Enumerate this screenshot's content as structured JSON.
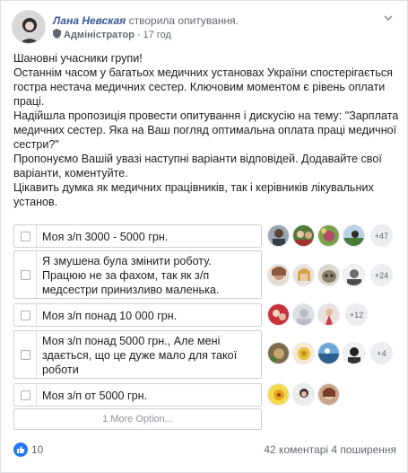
{
  "post": {
    "author": "Лана Невская",
    "action": "створила опитування.",
    "role": "Адміністратор",
    "separator": "·",
    "time": "17 год",
    "text_lines": [
      "Шановні учасники групи!",
      "Останнім часом у багатьох медичних установах України спостерігається гостра нестача медичних сестер. Ключовим моментом є рівень оплати праці.",
      "Надійшла пропозиція провести опитування і дискусію на тему: \"Зарплата медичних сестер. Яка на Ваш погляд оптимальна оплата праці медичної сестри?\"",
      "Пропонуємо Вашій увазі наступні варіанти відповідей. Додавайте свої варіанти, коментуйте.",
      "Цікавить думка як медичних працівників, так і керівників лікувальних установ."
    ]
  },
  "poll": {
    "options": [
      {
        "label": "Моя з/п 3000 - 5000 грн.",
        "more": "+47"
      },
      {
        "label": "Я змушена була змінити роботу. Працюю не за фахом, так як з/п медсестри принизливо маленька.",
        "more": "+24"
      },
      {
        "label": "Моя з/п понад 10 000 грн.",
        "more": "+12"
      },
      {
        "label": "Моя з/п понад 5000 грн., Але мені здається, що це дуже мало для такої роботи",
        "more": "+4"
      },
      {
        "label": "Моя з/п от 5000 грн.",
        "more": ""
      }
    ],
    "more_options_label": "1 More Option..."
  },
  "footer": {
    "likes": "10",
    "comments": "42 коментарі",
    "shares": "4 поширення"
  },
  "colors": {
    "link": "#385898",
    "like_blue": "#2078f4",
    "border": "#ccd0d5"
  }
}
